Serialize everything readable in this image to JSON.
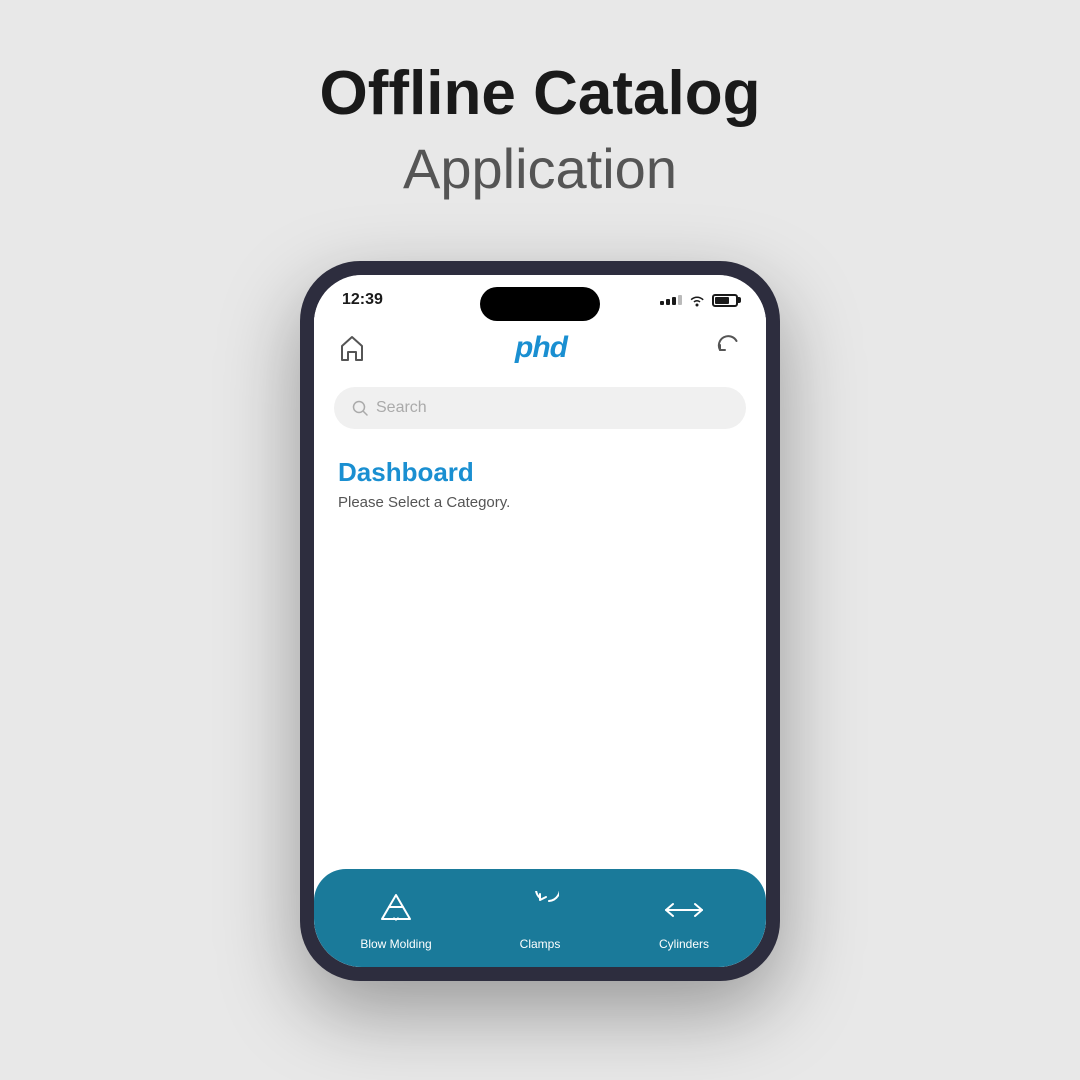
{
  "header": {
    "title": "Offline Catalog",
    "subtitle": "Application"
  },
  "phone": {
    "status_bar": {
      "time": "12:39",
      "signal": "signal",
      "wifi": "wifi",
      "battery": "battery"
    },
    "app_header": {
      "logo": "phd",
      "home_icon": "home",
      "refresh_icon": "refresh"
    },
    "search": {
      "placeholder": "Search"
    },
    "dashboard": {
      "title": "Dashboard",
      "subtitle": "Please Select a Category."
    },
    "nav": {
      "items": [
        {
          "label": "Blow Molding",
          "icon": "recycle"
        },
        {
          "label": "Clamps",
          "icon": "rotate"
        },
        {
          "label": "Cylinders",
          "icon": "arrows"
        }
      ]
    }
  }
}
